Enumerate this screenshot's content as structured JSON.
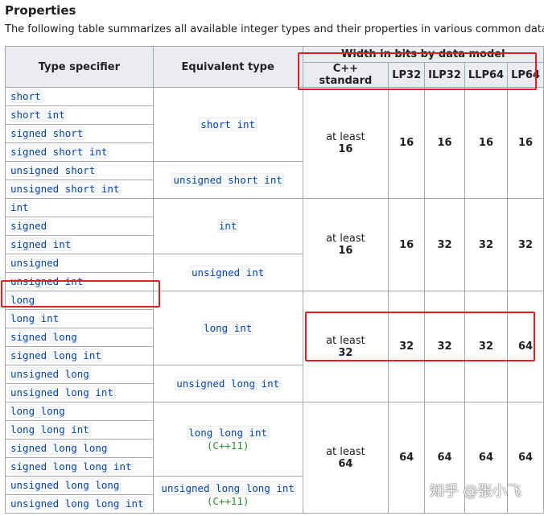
{
  "heading": "Properties",
  "intro": "The following table summarizes all available integer types and their properties in various common data m",
  "table": {
    "header_type": "Type specifier",
    "header_equiv": "Equivalent type",
    "header_width": "Width in bits by data model",
    "sub_headers": [
      "C++ standard",
      "LP32",
      "ILP32",
      "LLP64",
      "LP64"
    ],
    "groups": [
      {
        "at_least": "at least",
        "std_value": "16",
        "values": [
          "16",
          "16",
          "16",
          "16"
        ],
        "subgroups": [
          {
            "equiv": "short int",
            "std_note": "",
            "types": [
              "short",
              "short int",
              "signed short",
              "signed short int"
            ]
          },
          {
            "equiv": "unsigned short int",
            "std_note": "",
            "types": [
              "unsigned short",
              "unsigned short int"
            ]
          }
        ]
      },
      {
        "at_least": "at least",
        "std_value": "16",
        "values": [
          "16",
          "32",
          "32",
          "32"
        ],
        "subgroups": [
          {
            "equiv": "int",
            "std_note": "",
            "types": [
              "int",
              "signed",
              "signed int"
            ]
          },
          {
            "equiv": "unsigned int",
            "std_note": "",
            "types": [
              "unsigned",
              "unsigned int"
            ]
          }
        ]
      },
      {
        "at_least": "at least",
        "std_value": "32",
        "values": [
          "32",
          "32",
          "32",
          "64"
        ],
        "subgroups": [
          {
            "equiv": "long int",
            "std_note": "",
            "types": [
              "long",
              "long int",
              "signed long",
              "signed long int"
            ]
          },
          {
            "equiv": "unsigned long int",
            "std_note": "",
            "types": [
              "unsigned long",
              "unsigned long int"
            ]
          }
        ]
      },
      {
        "at_least": "at least",
        "std_value": "64",
        "values": [
          "64",
          "64",
          "64",
          "64"
        ],
        "subgroups": [
          {
            "equiv": "long long int",
            "std_note": "(C++11)",
            "types": [
              "long long",
              "long long int",
              "signed long long",
              "signed long long int"
            ]
          },
          {
            "equiv": "unsigned long long int",
            "std_note": "(C++11)",
            "types": [
              "unsigned long long",
              "unsigned long long int"
            ]
          }
        ]
      }
    ]
  },
  "watermark": "知乎 @张小飞",
  "colors": {
    "highlight": "#e02020",
    "code_text": "#0645ad",
    "std_note": "#2e8b2e",
    "header_bg": "#eaecf0",
    "border": "#a2a9b1"
  }
}
